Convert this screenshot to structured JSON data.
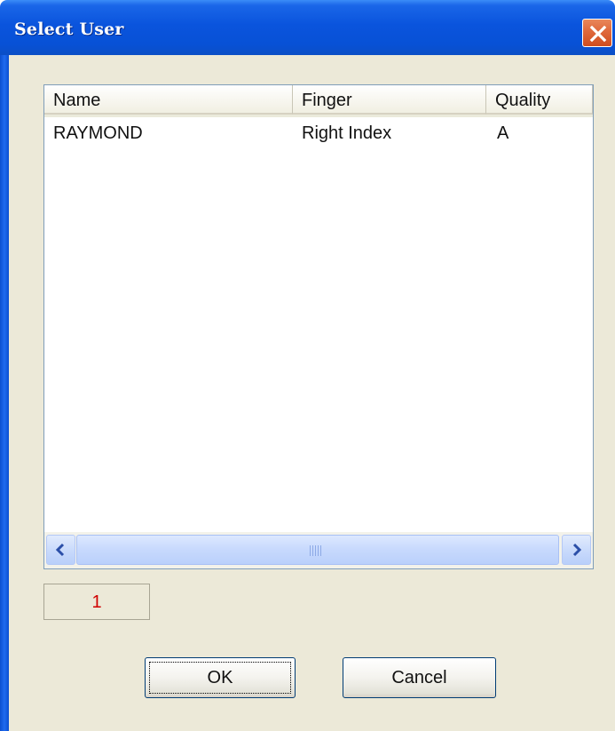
{
  "window": {
    "title": "Select User"
  },
  "list": {
    "columns": [
      "Name",
      "Finger",
      "Quality"
    ],
    "rows": [
      {
        "name": "RAYMOND",
        "finger": "Right Index",
        "quality": "A"
      }
    ]
  },
  "count": "1",
  "buttons": {
    "ok": "OK",
    "cancel": "Cancel"
  },
  "icons": {
    "close": "close-icon",
    "left": "arrow-left-icon",
    "right": "arrow-right-icon"
  }
}
